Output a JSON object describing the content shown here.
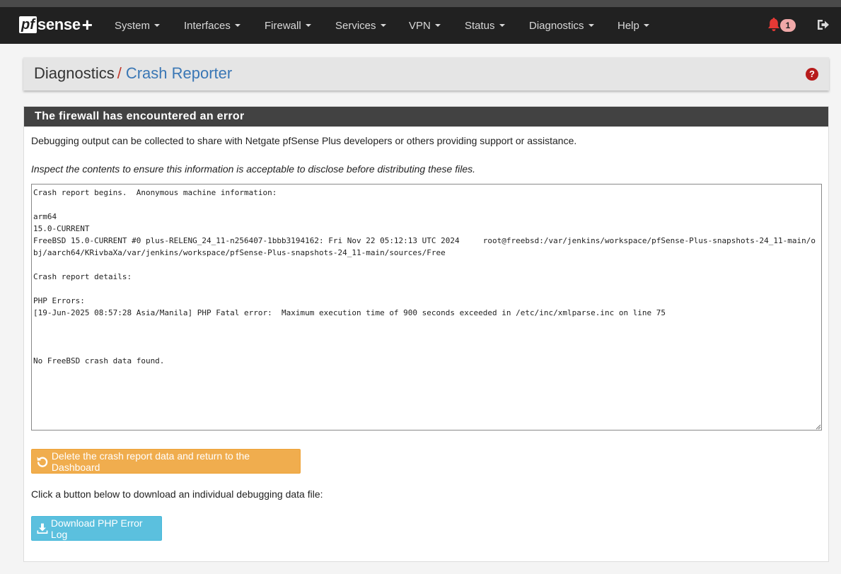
{
  "brand": {
    "pf": "pf",
    "sense": "sense",
    "plus": "+"
  },
  "nav": {
    "items": [
      {
        "label": "System"
      },
      {
        "label": "Interfaces"
      },
      {
        "label": "Firewall"
      },
      {
        "label": "Services"
      },
      {
        "label": "VPN"
      },
      {
        "label": "Status"
      },
      {
        "label": "Diagnostics"
      },
      {
        "label": "Help"
      }
    ],
    "notification_count": "1"
  },
  "breadcrumb": {
    "parent": "Diagnostics",
    "separator": "/",
    "current": "Crash Reporter",
    "help": "?"
  },
  "panel": {
    "title": "The firewall has encountered an error",
    "intro": "Debugging output can be collected to share with Netgate pfSense Plus developers or others providing support or assistance.",
    "warning": "Inspect the contents to ensure this information is acceptable to disclose before distributing these files.",
    "report": "Crash report begins.  Anonymous machine information:\n\narm64\n15.0-CURRENT\nFreeBSD 15.0-CURRENT #0 plus-RELENG_24_11-n256407-1bbb3194162: Fri Nov 22 05:12:13 UTC 2024     root@freebsd:/var/jenkins/workspace/pfSense-Plus-snapshots-24_11-main/obj/aarch64/KRivbaXa/var/jenkins/workspace/pfSense-Plus-snapshots-24_11-main/sources/Free\n\nCrash report details:\n\nPHP Errors:\n[19-Jun-2025 08:57:28 Asia/Manila] PHP Fatal error:  Maximum execution time of 900 seconds exceeded in /etc/inc/xmlparse.inc on line 75\n\n\n\nNo FreeBSD crash data found.",
    "delete_button": "Delete the crash report data and return to the Dashboard",
    "download_prompt": "Click a button below to download an individual debugging data file:",
    "download_button": "Download PHP Error Log"
  },
  "colors": {
    "navbar": "#212121",
    "accent_link": "#3a77b5",
    "warning_button": "#f0ad4e",
    "info_button": "#5bc0de",
    "alert_red": "#e53935"
  }
}
